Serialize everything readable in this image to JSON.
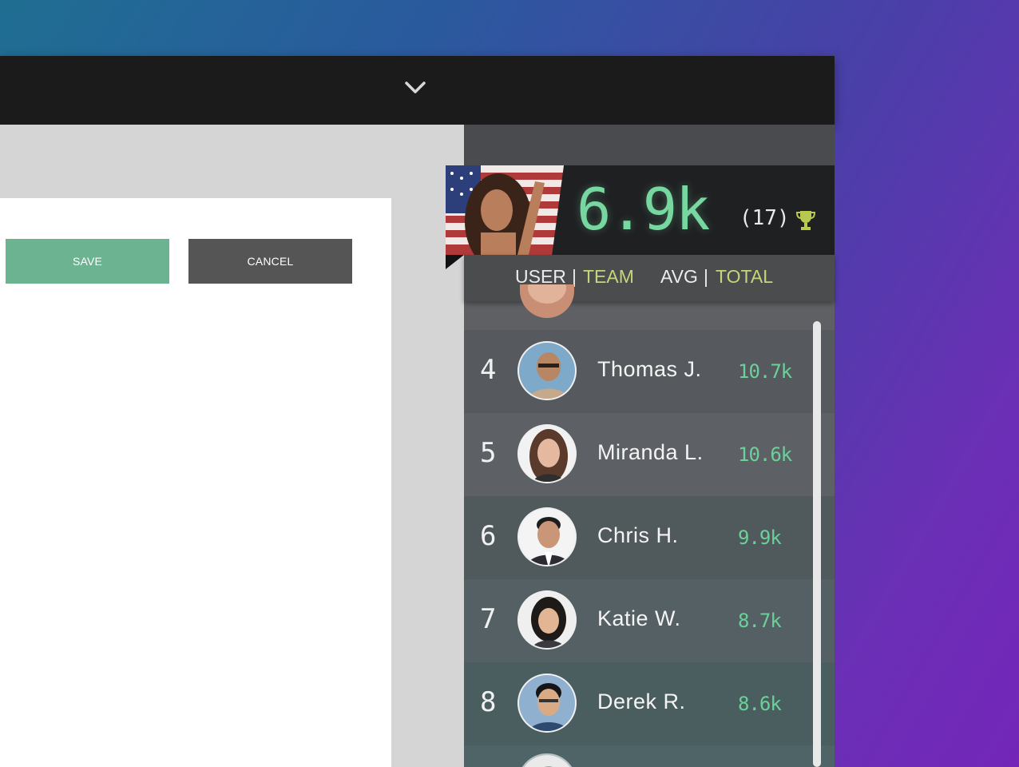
{
  "toolbar": {
    "chevron_icon": "chevron-down-icon"
  },
  "form": {
    "save_label": "SAVE",
    "cancel_label": "CANCEL"
  },
  "leaderboard": {
    "current_user": {
      "score": "6.9k",
      "rank": "(17)",
      "trophy_icon": "trophy-icon"
    },
    "filters": {
      "user": "USER",
      "sep1": "|",
      "team": "TEAM",
      "avg": "AVG",
      "sep2": "|",
      "total": "TOTAL"
    },
    "rows": [
      {
        "rank": "4",
        "name": "Thomas  J.",
        "score": "10.7k",
        "accent": "#c89a72"
      },
      {
        "rank": "5",
        "name": "Miranda  L.",
        "score": "10.6k",
        "accent": "#6a4a3a"
      },
      {
        "rank": "6",
        "name": "Chris  H.",
        "score": "9.9k",
        "accent": "#2b2b30"
      },
      {
        "rank": "7",
        "name": "Katie  W.",
        "score": "8.7k",
        "accent": "#2c2420"
      },
      {
        "rank": "8",
        "name": "Derek  R.",
        "score": "8.6k",
        "accent": "#1c1c22"
      }
    ]
  },
  "colors": {
    "accent_green": "#77d7a0",
    "highlight": "#c5d57a",
    "save_button": "#6cb391",
    "cancel_button": "#555556"
  }
}
